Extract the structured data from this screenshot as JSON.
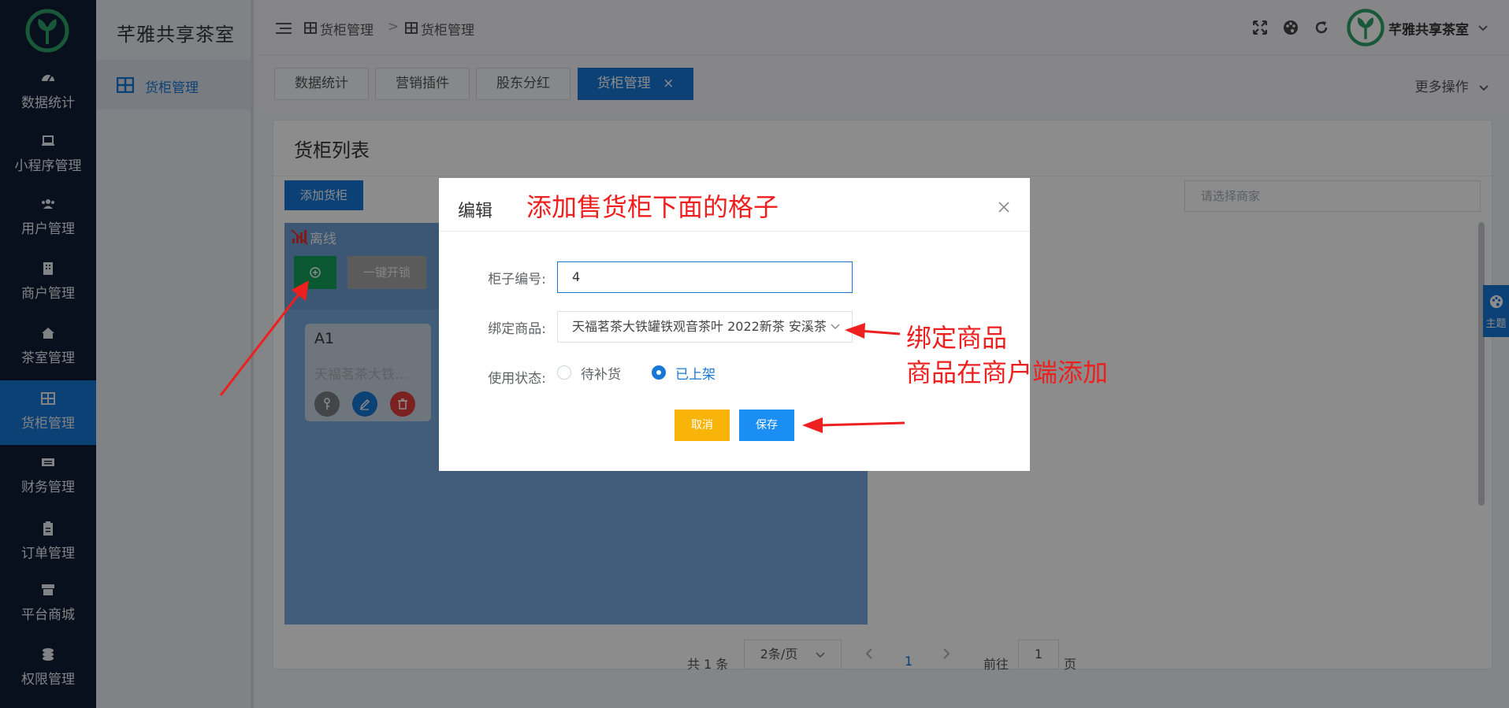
{
  "sidebar": {
    "items": [
      {
        "label": "数据统计",
        "icon": "dashboard-icon"
      },
      {
        "label": "小程序管理",
        "icon": "laptop-icon"
      },
      {
        "label": "用户管理",
        "icon": "users-icon"
      },
      {
        "label": "商户管理",
        "icon": "building-icon"
      },
      {
        "label": "茶室管理",
        "icon": "home-icon"
      },
      {
        "label": "货柜管理",
        "icon": "grid-icon"
      },
      {
        "label": "财务管理",
        "icon": "money-icon"
      },
      {
        "label": "订单管理",
        "icon": "clipboard-icon"
      },
      {
        "label": "平台商城",
        "icon": "store-icon"
      },
      {
        "label": "权限管理",
        "icon": "coins-icon"
      }
    ]
  },
  "submenu": {
    "brand": "芊雅共享茶室",
    "item": "货柜管理"
  },
  "header": {
    "crumb1": "货柜管理",
    "crumb_sep": ">",
    "crumb2": "货柜管理",
    "user": "芊雅共享茶室"
  },
  "tabs": [
    {
      "label": "数据统计"
    },
    {
      "label": "营销插件"
    },
    {
      "label": "股东分红"
    },
    {
      "label": "货柜管理",
      "close": "×"
    }
  ],
  "more_ops": "更多操作",
  "content": {
    "title": "货柜列表",
    "add_button": "添加货柜",
    "merchant_placeholder": "请选择商家",
    "cabinet": {
      "status": "离线",
      "unlock_all": "一键开锁",
      "cell_name": "A1",
      "cell_goods": "天福茗茶大铁..."
    }
  },
  "pagination": {
    "total": "共 1 条",
    "page_size": "2条/页",
    "current": "1",
    "goto_label": "前往",
    "goto_value": "1",
    "page_unit": "页"
  },
  "theme_tab": "主题",
  "dialog": {
    "title": "编辑",
    "cabinet_no_label": "柜子编号:",
    "cabinet_no_value": "4",
    "goods_label": "绑定商品:",
    "goods_value": "天福茗茶大铁罐铁观音茶叶 2022新茶 安溪茶",
    "status_label": "使用状态:",
    "status_options": [
      "待补货",
      "已上架"
    ],
    "selected_status": "已上架",
    "cancel": "取消",
    "save": "保存"
  },
  "annotations": {
    "top": "添加售货柜下面的格子",
    "bind_line1": "绑定商品",
    "bind_line2": "商品在商户端添加"
  },
  "colors": {
    "sidebar_bg": "#0f1c36",
    "primary": "#1677d7",
    "warning": "#f9b40a",
    "annotation": "#ee1f1f",
    "success": "#11a15a"
  }
}
